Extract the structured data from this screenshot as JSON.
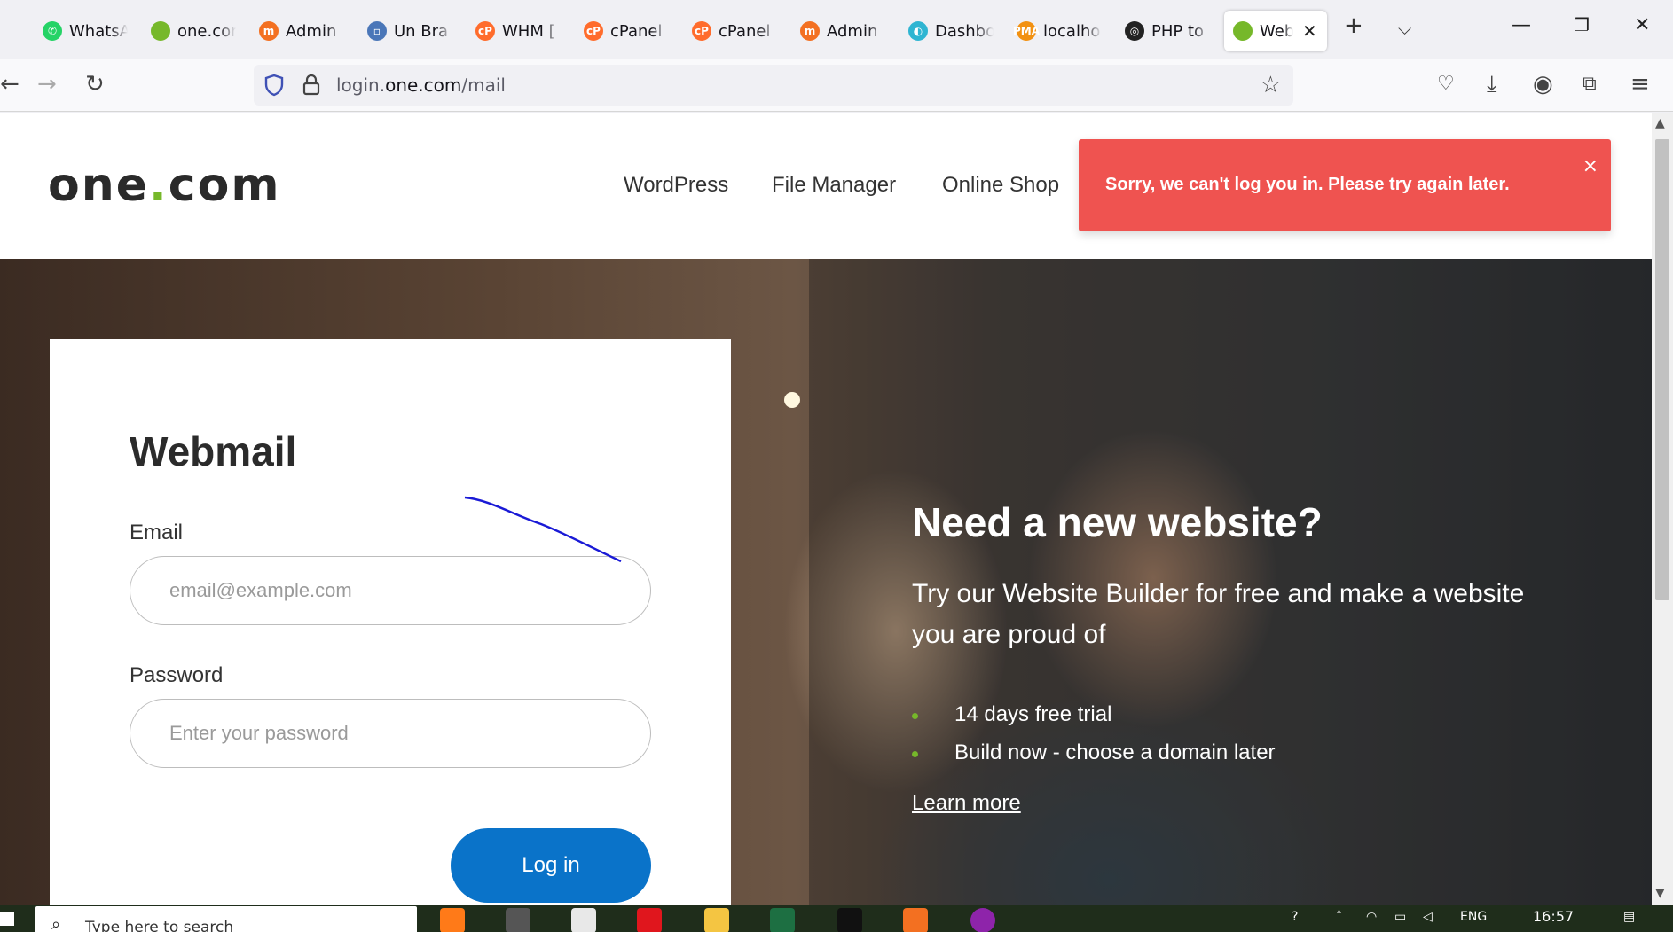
{
  "browser": {
    "tabs": [
      {
        "label": "WhatsA",
        "fav_color": "#25d366",
        "fav_glyph": "✆"
      },
      {
        "label": "one.cor",
        "fav_color": "#76b82a",
        "fav_glyph": ""
      },
      {
        "label": "Admin",
        "fav_color": "#f37021",
        "fav_glyph": "m"
      },
      {
        "label": "Un Bra",
        "fav_color": "#4a76b8",
        "fav_glyph": "▫"
      },
      {
        "label": "WHM [",
        "fav_color": "#ff6c2c",
        "fav_glyph": "cP"
      },
      {
        "label": "cPanel",
        "fav_color": "#ff6c2c",
        "fav_glyph": "cP"
      },
      {
        "label": "cPanel",
        "fav_color": "#ff6c2c",
        "fav_glyph": "cP"
      },
      {
        "label": "Admin",
        "fav_color": "#f37021",
        "fav_glyph": "m"
      },
      {
        "label": "Dashbo",
        "fav_color": "#2fb5d2",
        "fav_glyph": "◐"
      },
      {
        "label": "localho",
        "fav_color": "#f29111",
        "fav_glyph": "PMA"
      },
      {
        "label": "PHP to",
        "fav_color": "#222222",
        "fav_glyph": "◎"
      },
      {
        "label": "Web",
        "fav_color": "#76b82a",
        "fav_glyph": "",
        "active": true
      }
    ],
    "url_domain_pre": "login.",
    "url_domain": "one.com",
    "url_path": "/mail"
  },
  "site": {
    "logo_a": "one",
    "logo_dot": ".",
    "logo_b": "com",
    "menu": [
      "WordPress",
      "File Manager",
      "Online Shop"
    ],
    "toast_message": "Sorry, we can't log you in. Please try again later.",
    "toast_close": "×"
  },
  "login": {
    "title": "Webmail",
    "email_label": "Email",
    "email_placeholder": "email@example.com",
    "password_label": "Password",
    "password_placeholder": "Enter your password",
    "submit": "Log in"
  },
  "promo": {
    "title": "Need a new website?",
    "subtitle": "Try our Website Builder for free and make a website you are proud of",
    "bullets": [
      "14 days free trial",
      "Build now - choose a domain later"
    ],
    "link": "Learn more"
  },
  "taskbar": {
    "search_placeholder": "Type here to search",
    "lang": "ENG",
    "time": "16:57"
  },
  "colors": {
    "brand_green": "#76b82a",
    "toast_red": "#ef5350",
    "button_blue": "#0a73c9"
  }
}
